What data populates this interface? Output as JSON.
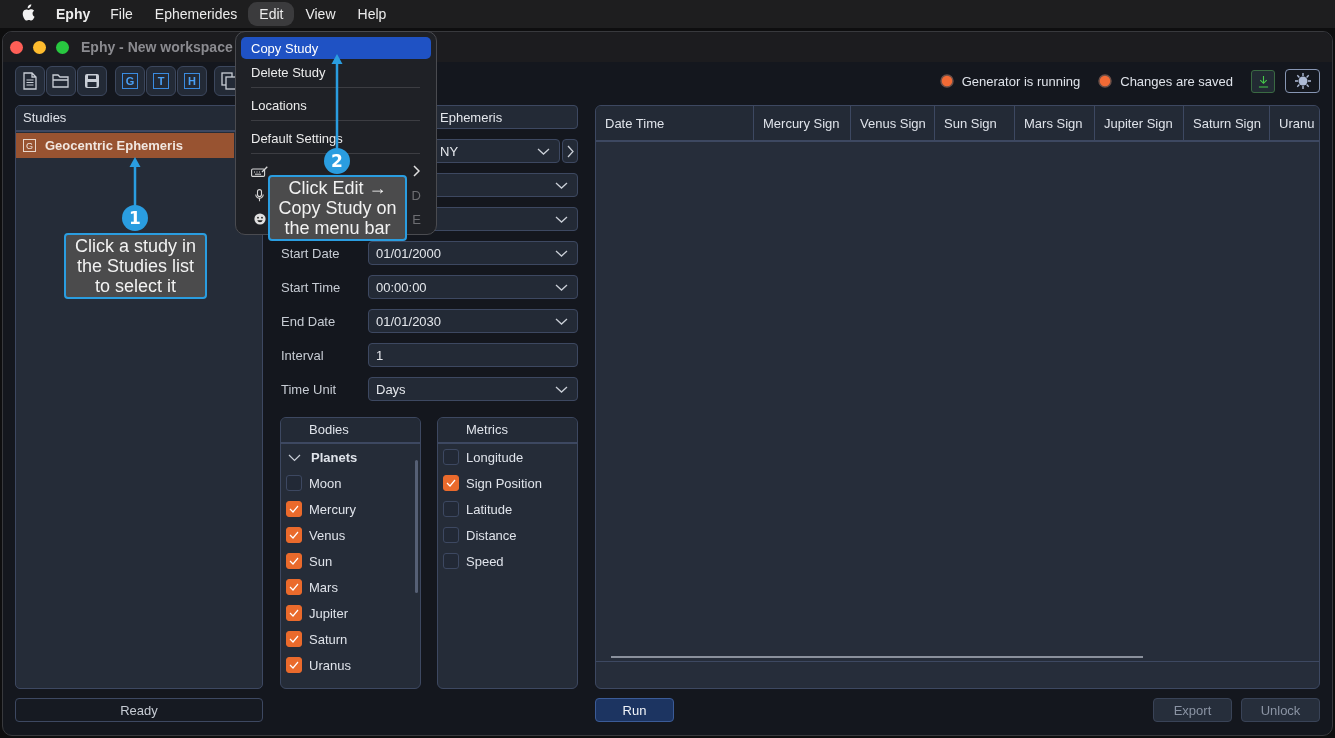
{
  "menu_bar": {
    "app_name": "Ephy",
    "items": [
      {
        "label": "File",
        "selected": false
      },
      {
        "label": "Ephemerides",
        "selected": false
      },
      {
        "label": "Edit",
        "selected": true
      },
      {
        "label": "View",
        "selected": false
      },
      {
        "label": "Help",
        "selected": false
      }
    ]
  },
  "window": {
    "title": "Ephy - New workspace"
  },
  "toolbar": {
    "letter_buttons": [
      "G",
      "T",
      "H"
    ],
    "status": [
      {
        "label": "Generator is running",
        "on": true
      },
      {
        "label": "Changes are saved",
        "on": true
      }
    ]
  },
  "studies": {
    "title": "Studies",
    "items": [
      {
        "badge": "G",
        "label": "Geocentric Ephemeris",
        "selected": true
      }
    ]
  },
  "form": {
    "rows": [
      {
        "kind": "text",
        "value": "Ephemeris"
      },
      {
        "kind": "select",
        "value": "NY",
        "next_button": true
      },
      {
        "kind": "select"
      },
      {
        "kind": "select"
      },
      {
        "kind": "select",
        "label": "Start Date",
        "value": "01/01/2000"
      },
      {
        "kind": "select",
        "label": "Start Time",
        "value": "00:00:00"
      },
      {
        "kind": "select",
        "label": "End Date",
        "value": "01/01/2030"
      },
      {
        "kind": "text",
        "label": "Interval",
        "value": "1"
      },
      {
        "kind": "select",
        "label": "Time Unit",
        "value": "Days"
      }
    ]
  },
  "bodies": {
    "title": "Bodies",
    "groups": [
      {
        "label": "Planets",
        "expanded": true,
        "children": [
          {
            "label": "Moon",
            "checked": false
          },
          {
            "label": "Mercury",
            "checked": true
          },
          {
            "label": "Venus",
            "checked": true
          },
          {
            "label": "Sun",
            "checked": true
          },
          {
            "label": "Mars",
            "checked": true
          },
          {
            "label": "Jupiter",
            "checked": true
          },
          {
            "label": "Saturn",
            "checked": true
          },
          {
            "label": "Uranus",
            "checked": true
          }
        ]
      }
    ]
  },
  "metrics": {
    "title": "Metrics",
    "items": [
      {
        "label": "Longitude",
        "checked": false
      },
      {
        "label": "Sign Position",
        "checked": true
      },
      {
        "label": "Latitude",
        "checked": false
      },
      {
        "label": "Distance",
        "checked": false
      },
      {
        "label": "Speed",
        "checked": false
      }
    ]
  },
  "table": {
    "columns": [
      "Date Time",
      "Mercury Sign",
      "Venus Sign",
      "Sun Sign",
      "Mars Sign",
      "Jupiter Sign",
      "Saturn Sign",
      "Uranu"
    ]
  },
  "status_bar": {
    "text": "Ready"
  },
  "buttons": [
    {
      "label": "Run",
      "disabled": false
    },
    {
      "label": "Export",
      "disabled": true
    },
    {
      "label": "Unlock",
      "disabled": true
    }
  ],
  "edit_menu": {
    "items": [
      {
        "kind": "item",
        "label": "Copy Study",
        "selected": true
      },
      {
        "kind": "item",
        "label": "Delete Study",
        "selected": false
      },
      {
        "kind": "separator"
      },
      {
        "kind": "item",
        "label": "Locations",
        "selected": false
      },
      {
        "kind": "separator"
      },
      {
        "kind": "item",
        "label": "Default Settings",
        "selected": false
      },
      {
        "kind": "separator"
      },
      {
        "kind": "autofill",
        "submenu": true,
        "selected": false
      },
      {
        "kind": "dictation",
        "shortcut": "D",
        "selected": false
      },
      {
        "kind": "emoji",
        "shortcut": "E",
        "selected": false
      }
    ]
  },
  "annotations": [
    {
      "number": "1",
      "text": "Click a study in the Studies list to select it"
    },
    {
      "number": "2",
      "text": "Click Edit → Copy Study on the menu bar"
    }
  ]
}
